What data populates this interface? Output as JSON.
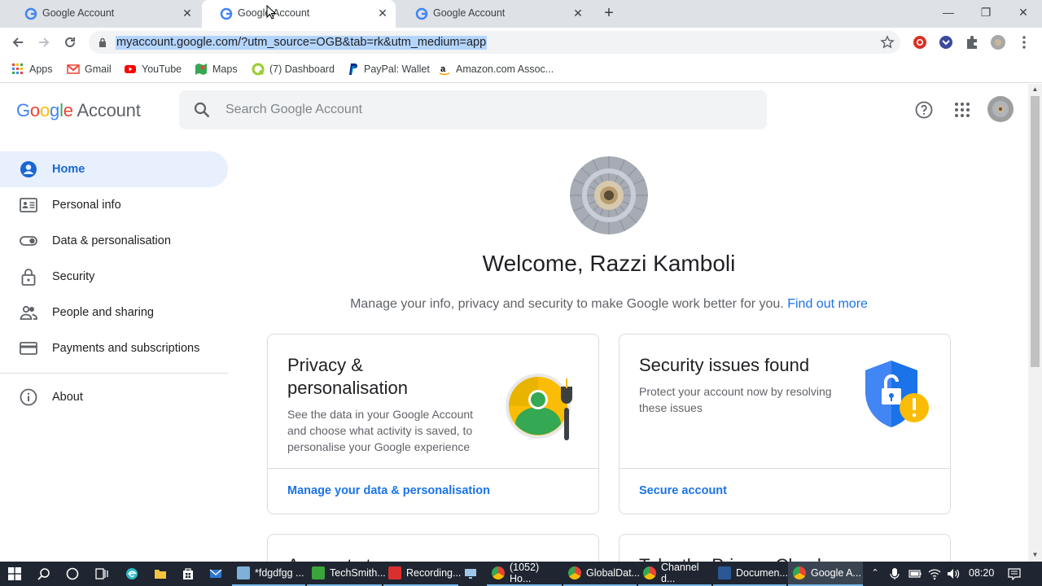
{
  "browser": {
    "tabs": [
      {
        "title": "Google Account",
        "active": false
      },
      {
        "title": "Google Account",
        "active": true
      },
      {
        "title": "Google Account",
        "active": false
      }
    ],
    "url": "myaccount.google.com/?utm_source=OGB&tab=rk&utm_medium=app",
    "bookmarks": [
      "Apps",
      "Gmail",
      "YouTube",
      "Maps",
      "(7) Dashboard",
      "PayPal: Wallet",
      "Amazon.com Assoc..."
    ]
  },
  "header": {
    "logo_google": "Google",
    "logo_account": "Account",
    "search_placeholder": "Search Google Account"
  },
  "sidebar": {
    "items": [
      {
        "label": "Home",
        "icon": "person-circle-icon",
        "active": true
      },
      {
        "label": "Personal info",
        "icon": "id-card-icon"
      },
      {
        "label": "Data & personalisation",
        "icon": "toggle-icon"
      },
      {
        "label": "Security",
        "icon": "lock-icon"
      },
      {
        "label": "People and sharing",
        "icon": "people-icon"
      },
      {
        "label": "Payments and subscriptions",
        "icon": "credit-card-icon"
      },
      {
        "label": "About",
        "icon": "info-icon"
      }
    ]
  },
  "main": {
    "welcome": "Welcome, Razzi Kamboli",
    "subtitle": "Manage your info, privacy and security to make Google work better for you.",
    "find_out_more": "Find out more",
    "cards": [
      {
        "title": "Privacy & personalisation",
        "description": "See the data in your Google Account and choose what activity is saved, to personalise your Google experience",
        "link": "Manage your data & personalisation"
      },
      {
        "title": "Security issues found",
        "description": "Protect your account now by resolving these issues",
        "link": "Secure account"
      },
      {
        "title": "Account storage"
      },
      {
        "title": "Take the Privacy Check-up"
      }
    ]
  },
  "taskbar": {
    "items": [
      "*fdgdfgg ...",
      "TechSmith...",
      "Recording...",
      "(1052) Ho...",
      "GlobalDat...",
      "Channel d...",
      "Documen...",
      "Google A..."
    ],
    "time": "08:20"
  },
  "colors": {
    "accent": "#1a73e8",
    "active_nav_bg": "#e8f0fe",
    "taskbar": "#1f2631"
  }
}
